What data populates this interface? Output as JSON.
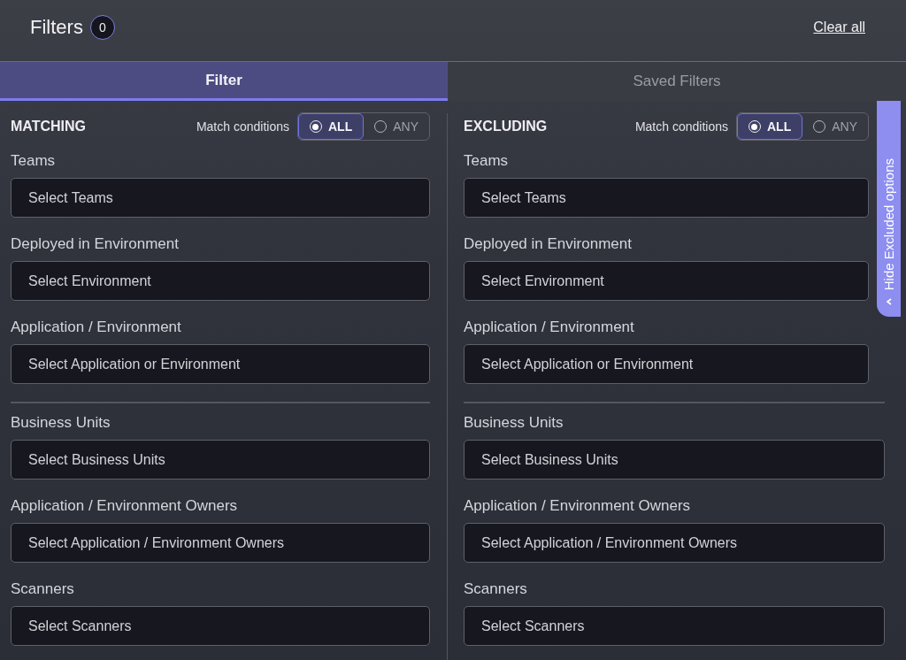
{
  "header": {
    "title": "Filters",
    "count": "0",
    "clear_link": "Clear all"
  },
  "tabs": [
    {
      "label": "Filter",
      "selected": true
    },
    {
      "label": "Saved Filters",
      "selected": false
    }
  ],
  "columns": [
    {
      "heading": "MATCHING",
      "match_label": "Match conditions",
      "options": [
        {
          "label": "ALL",
          "selected": true
        },
        {
          "label": "ANY",
          "selected": false
        }
      ],
      "groups": [
        [
          {
            "label": "Teams",
            "placeholder": "Select Teams"
          },
          {
            "label": "Deployed in Environment",
            "placeholder": "Select Environment"
          },
          {
            "label": "Application / Environment",
            "placeholder": "Select Application or Environment"
          }
        ],
        [
          {
            "label": "Business Units",
            "placeholder": "Select Business Units"
          },
          {
            "label": "Application / Environment Owners",
            "placeholder": "Select Application / Environment Owners"
          },
          {
            "label": "Scanners",
            "placeholder": "Select Scanners"
          }
        ]
      ]
    },
    {
      "heading": "EXCLUDING",
      "match_label": "Match conditions",
      "options": [
        {
          "label": "ALL",
          "selected": true
        },
        {
          "label": "ANY",
          "selected": false
        }
      ],
      "groups": [
        [
          {
            "label": "Teams",
            "placeholder": "Select Teams"
          },
          {
            "label": "Deployed in Environment",
            "placeholder": "Select Environment"
          },
          {
            "label": "Application / Environment",
            "placeholder": "Select Application or Environment"
          }
        ],
        [
          {
            "label": "Business Units",
            "placeholder": "Select Business Units"
          },
          {
            "label": "Application / Environment Owners",
            "placeholder": "Select Application / Environment Owners"
          },
          {
            "label": "Scanners",
            "placeholder": "Select Scanners"
          }
        ]
      ]
    }
  ],
  "side_tab": {
    "label": "Hide Excluded options"
  }
}
